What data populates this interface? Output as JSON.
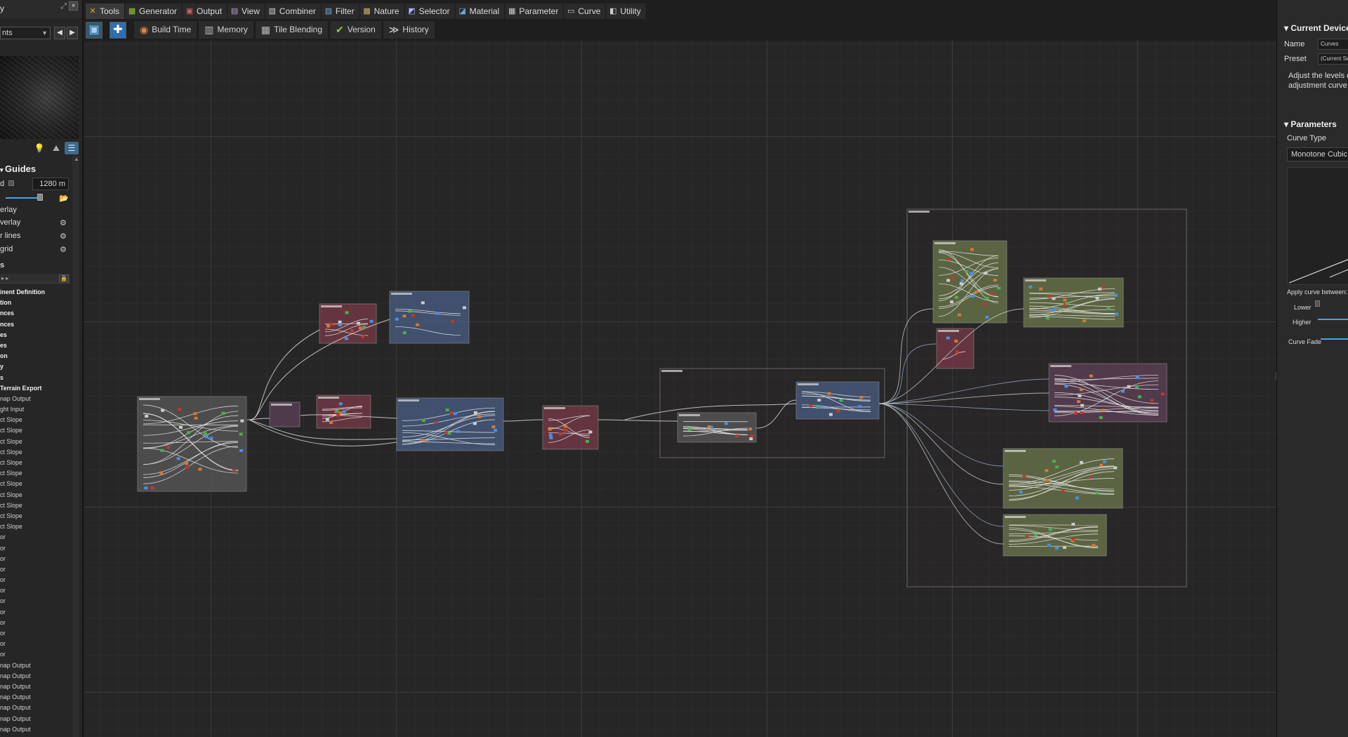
{
  "left_panel": {
    "title": "y",
    "selector_value": "nts",
    "section_title": "Guides",
    "scale_value": "1280 m",
    "row_label_first": "d",
    "toggles": [
      "erlay",
      "verlay",
      "r lines",
      "grid"
    ],
    "list_header": "s",
    "tree_items": [
      {
        "label": "inent Definition",
        "bold": true
      },
      {
        "label": "tion",
        "bold": true
      },
      {
        "label": "nces",
        "bold": true
      },
      {
        "label": "nces",
        "bold": true
      },
      {
        "label": "es",
        "bold": true
      },
      {
        "label": "es",
        "bold": true
      },
      {
        "label": "on",
        "bold": true
      },
      {
        "label": "y",
        "bold": true
      },
      {
        "label": "s",
        "bold": true
      },
      {
        "label": "Terrain Export",
        "bold": true
      },
      {
        "label": "nap Output",
        "bold": false
      },
      {
        "label": "ght Input",
        "bold": false
      },
      {
        "label": "ct Slope",
        "bold": false
      },
      {
        "label": "ct Slope",
        "bold": false
      },
      {
        "label": "ct Slope",
        "bold": false
      },
      {
        "label": "ct Slope",
        "bold": false
      },
      {
        "label": "ct Slope",
        "bold": false
      },
      {
        "label": "ct Slope",
        "bold": false
      },
      {
        "label": "ct Slope",
        "bold": false
      },
      {
        "label": "ct Slope",
        "bold": false
      },
      {
        "label": "ct Slope",
        "bold": false
      },
      {
        "label": "ct Slope",
        "bold": false
      },
      {
        "label": "ct Slope",
        "bold": false
      },
      {
        "label": "or",
        "bold": false
      },
      {
        "label": "or",
        "bold": false
      },
      {
        "label": "or",
        "bold": false
      },
      {
        "label": "or",
        "bold": false
      },
      {
        "label": "or",
        "bold": false
      },
      {
        "label": "or",
        "bold": false
      },
      {
        "label": "or",
        "bold": false
      },
      {
        "label": "or",
        "bold": false
      },
      {
        "label": "or",
        "bold": false
      },
      {
        "label": "or",
        "bold": false
      },
      {
        "label": "or",
        "bold": false
      },
      {
        "label": "or",
        "bold": false
      },
      {
        "label": "nap Output",
        "bold": false
      },
      {
        "label": "nap Output",
        "bold": false
      },
      {
        "label": "nap Output",
        "bold": false
      },
      {
        "label": "nap Output",
        "bold": false
      },
      {
        "label": "nap Output",
        "bold": false
      },
      {
        "label": "nap Output",
        "bold": false
      },
      {
        "label": "nap Output",
        "bold": false
      },
      {
        "label": "nap Output",
        "bold": false
      }
    ]
  },
  "toolbar": {
    "tabs": [
      {
        "label": "Tools",
        "icon": "tools-icon",
        "color": "#d9a441",
        "glyph": "✕"
      },
      {
        "label": "Generator",
        "icon": "generator-icon",
        "color": "#9acd32",
        "glyph": "▦"
      },
      {
        "label": "Output",
        "icon": "output-icon",
        "color": "#d06060",
        "glyph": "▣"
      },
      {
        "label": "View",
        "icon": "view-icon",
        "color": "#c0a0d0",
        "glyph": "▤"
      },
      {
        "label": "Combiner",
        "icon": "combiner-icon",
        "color": "#d0d0d0",
        "glyph": "▧"
      },
      {
        "label": "Filter",
        "icon": "filter-icon",
        "color": "#6fa8dc",
        "glyph": "▨"
      },
      {
        "label": "Nature",
        "icon": "nature-icon",
        "color": "#c9b26a",
        "glyph": "▩"
      },
      {
        "label": "Selector",
        "icon": "selector-icon",
        "color": "#b0b0ff",
        "glyph": "◩"
      },
      {
        "label": "Material",
        "icon": "material-icon",
        "color": "#6fa8dc",
        "glyph": "◪"
      },
      {
        "label": "Parameter",
        "icon": "parameter-icon",
        "color": "#d0d0d0",
        "glyph": "▦"
      },
      {
        "label": "Curve",
        "icon": "curve-icon",
        "color": "#d0d0d0",
        "glyph": "▭"
      },
      {
        "label": "Utility",
        "icon": "utility-icon",
        "color": "#d0d0d0",
        "glyph": "◧"
      }
    ],
    "buttons": [
      {
        "label": "Build Time",
        "icon": "build-time-icon",
        "glyph": "◉",
        "color": "#e08850"
      },
      {
        "label": "Memory",
        "icon": "memory-icon",
        "glyph": "▥",
        "color": "#bbbbbb"
      },
      {
        "label": "Tile Blending",
        "icon": "tile-blending-icon",
        "glyph": "▦",
        "color": "#bbbbbb"
      },
      {
        "label": "Version",
        "icon": "version-check-icon",
        "glyph": "✔",
        "color": "#8fcf3f"
      },
      {
        "label": "History",
        "icon": "history-icon",
        "glyph": "≫",
        "color": "#dddddd"
      }
    ]
  },
  "right_panel": {
    "device_header": "Current Device",
    "name_label": "Name",
    "name_value": "Curves",
    "preset_label": "Preset",
    "preset_value": "(Current Se",
    "description": "Adjust the levels c adjustment curve",
    "params_header": "Parameters",
    "curve_type_label": "Curve Type",
    "curve_type_value": "Monotone Cubic",
    "apply_between_label": "Apply curve between:",
    "lower_label": "Lower",
    "higher_label": "Higher",
    "curve_fade_label": "Curve Fade"
  },
  "graph": {
    "colors": {
      "red_group": "#7a3b48",
      "blue_group": "#4a5f85",
      "green_group": "#6c7a4c",
      "purple_group": "#5e4258",
      "gray_group": "#5a5a5a",
      "wire": "#d8d8d8",
      "port_blue": "#4a90e2",
      "port_red": "#c0392b",
      "port_orange": "#d07a3a",
      "port_green": "#4caf50"
    }
  }
}
